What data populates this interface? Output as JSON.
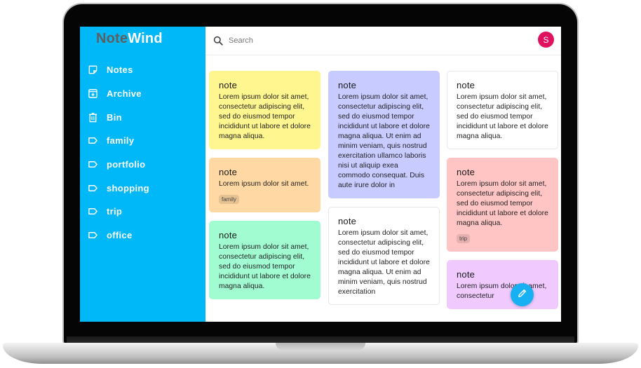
{
  "app": {
    "brand_part1": "Note",
    "brand_part2": "Wind"
  },
  "sidebar": {
    "items": [
      {
        "label": "Notes",
        "icon": "note-icon"
      },
      {
        "label": "Archive",
        "icon": "archive-icon"
      },
      {
        "label": "Bin",
        "icon": "trash-icon"
      },
      {
        "label": "family",
        "icon": "label-icon"
      },
      {
        "label": "portfolio",
        "icon": "label-icon"
      },
      {
        "label": "shopping",
        "icon": "label-icon"
      },
      {
        "label": "trip",
        "icon": "label-icon"
      },
      {
        "label": "office",
        "icon": "label-icon"
      }
    ]
  },
  "topbar": {
    "search_placeholder": "Search",
    "avatar_initial": "S",
    "avatar_color": "#e0115f"
  },
  "colors": {
    "sidebar": "#00b7f7",
    "fab": "#17b1f3"
  },
  "notes": {
    "col1": [
      {
        "title": "note",
        "body": "Lorem ipsum dolor sit amet, consectetur adipiscing elit, sed do eiusmod tempor incididunt ut labore et dolore magna aliqua.",
        "color": "#fff68f",
        "tag": ""
      },
      {
        "title": "note",
        "body": "Lorem ipsum dolor sit amet.",
        "color": "#ffd8a3",
        "tag": "family"
      },
      {
        "title": "note",
        "body": "Lorem ipsum dolor sit amet, consectetur adipiscing elit, sed do eiusmod tempor incididunt ut labore et dolore magna aliqua.",
        "color": "#a2fcd2",
        "tag": ""
      }
    ],
    "col2": [
      {
        "title": "note",
        "body": "Lorem ipsum dolor sit amet, consectetur adipiscing elit, sed do eiusmod tempor incididunt ut labore et dolore magna aliqua. Ut enim ad minim veniam, quis nostrud exercitation ullamco laboris nisi ut aliquip exea commodo consequat. Duis aute irure dolor in",
        "color": "#c8cbff",
        "tag": ""
      },
      {
        "title": "note",
        "body": "Lorem ipsum dolor sit amet, consectetur adipiscing elit, sed do eiusmod tempor incididunt ut labore et dolore magna aliqua. Ut enim ad minim veniam, quis nostrud exercitation",
        "color": "#ffffff",
        "tag": ""
      }
    ],
    "col3": [
      {
        "title": "note",
        "body": "Lorem ipsum dolor sit amet, consectetur adipiscing elit, sed do eiusmod tempor incididunt ut labore et dolore magna aliqua.",
        "color": "#ffffff",
        "tag": ""
      },
      {
        "title": "note",
        "body": "Lorem ipsum dolor sit amet, consectetur adipiscing elit, sed do eiusmod tempor incididunt ut labore et dolore magna aliqua.",
        "color": "#ffc5c5",
        "tag": "trip"
      },
      {
        "title": "note",
        "body": "Lorem ipsum dolor sit amet, consectetur",
        "color": "#f0caff",
        "tag": ""
      }
    ]
  },
  "fab": {
    "icon": "pencil-icon"
  }
}
